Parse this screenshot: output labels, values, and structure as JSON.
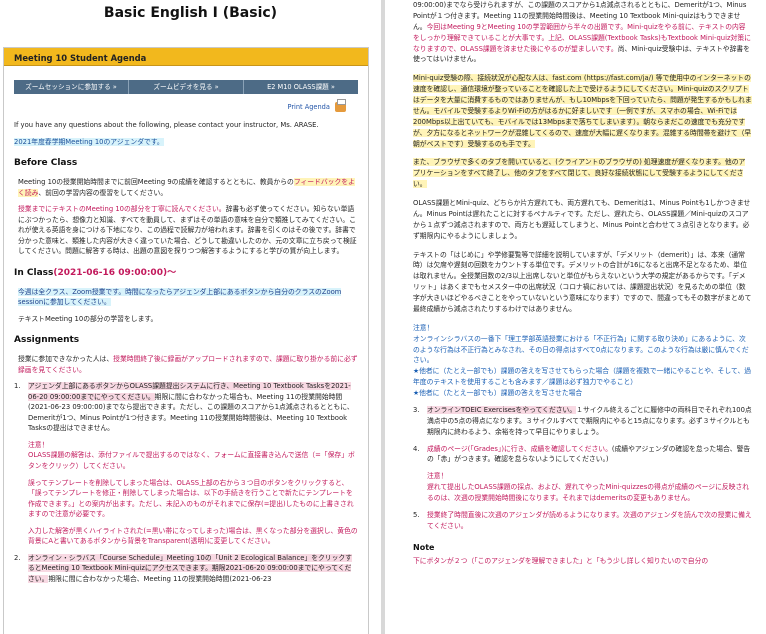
{
  "left": {
    "course_title": "Basic English I (Basic)",
    "agenda_title": "Meeting 10 Student Agenda",
    "nav": [
      "ズームセッションに参加する »",
      "ズームビデオを見る »",
      "E2 M10 OLASS課題 »"
    ],
    "print_label": "Print Agenda",
    "contact_text": "If you have any questions about the following, please contact your instructor, Ms. ARASE.",
    "agenda_year": "2021年度春学期Meeting 10のアジェンダです。",
    "before_class": {
      "heading": "Before Class",
      "p1a": "Meeting 10の授業開始時間までに前回Meeting 9の成績を確認するとともに、教員からの",
      "p1b": "フィードバックをよく読み",
      "p1c": "、前回の学習内容の復習をしてください。",
      "p2a": "授業までにテキストのMeeting 10の部分を丁寧に読んでください。",
      "p2b": "辞書も必ず使ってください。知らない単語にぶつかったら、想像力と知識、すべてを動員して、まずはその単語の意味を自分で類推してみてください。これが使える英語を身につける下地になり、この過程で読解力が培われます。辞書を引くのはその後です。辞書で分かった意味と、類推した内容が大きく違っていた場合、どうして勘違いしたのか、元の文章に立ち戻って検証してください。問題に解答する時は、出題の意図を探りつつ解答するようにすると学びの質が向上します。"
    },
    "in_class": {
      "heading": "In Class",
      "time": "(2021-06-16 09:00:00)～",
      "p1": "今週は全クラス、Zoom授業です。時間になったらアジェンダ上部にあるボタンから自分のクラスのZoom sessionに参加してください。",
      "p2": "テキストMeeting 10の部分の学習をします。"
    },
    "assignments": {
      "heading": "Assignments",
      "intro_a": "授業に参加できなかった人は、",
      "intro_b": "授業時間終了後に録画がアップロードされますので、課題に取り掛かる前に必ず録画を見てください。",
      "items": [
        {
          "num": "1.",
          "a": "アジェンダ上部にあるボタンからOLASS課題提出システムに行き、Meeting 10 Textbook Tasksを2021-06-20 09:00:00までにやってください。",
          "b": "期限に間に合わなかった場合も、Meeting 11の授業開始時間 (2021-06-23 09:00:00)までなら提出できます。ただし、この課題のスコアから1点減点されるとともに、Demeritが1つ、Minus Pointが1つ付きます。Meeting 11の授業開始時間後は、Meeting 10 Textbook Tasksの提出はできません。",
          "note_head": "注意！",
          "note_body": "OLASS課題の解答は、添付ファイルで提出するのではなく、フォームに直接書き込んで送信（=「保存」ボタンをクリック）してください。",
          "p3": "誤ってテンプレートを削除してしまった場合は、OLASS上部の右から３つ目のボタンをクリックすると、「誤ってテンプレートを修正・削除してしまった場合は、以下の手続きを行うことで新たにテンプレートを作成できます。」との案内が出ます。ただし、未記入のものがそれまでに保存(=提出)したものに上書きされますので注意が必要です。",
          "p4": "入力した解答が黒くハイライトされた(=黒い帯になってしまった)場合は、黒くなった部分を選択し、黄色の背景にAと書いてあるボタンから背景をTransparent(透明)に変更してください。"
        },
        {
          "num": "2.",
          "a": "オンライン・シラバス「Course Schedule」Meeting 10の「Unit 2 Ecological Balance」をクリックするとMeeting 10 Textbook Mini-quizにアクセスできます。期限2021-06-20 09:00:00までにやってください。",
          "b": "期限に間に合わなかった場合、Meeting 11の授業開始時間(2021-06-23"
        }
      ]
    }
  },
  "right": {
    "p_cont_a": "09:00:00)までなら受けられますが、この課題のスコアから1点減点されるとともに、Demeritが1つ、Minus Pointが１つ付きます。Meeting 11の授業開始時間後は、Meeting 10 Textbook Mini-quizはもうできません。",
    "p_cont_b": "今回はMeeting 9とMeeting 10の学習範囲から半々の出題です。",
    "p_cont_c": "Mini-quizをやる前に、テキストの内容をしっかり理解できていることが大事です。上記、OLASS課題(Textbook Tasks)もTextbook Mini-quiz対策になりますので、OLASS課題を済ませた後にやるのが望ましいです。",
    "p_cont_d": "尚、Mini-quiz受験中は、テキストや辞書を使ってはいけません。",
    "p_speed": "Mini-quiz受験の際、接続状況が心配な人は、fast.com (https://fast.com/ja/) 等で使用中のインターネットの速度を確認し、通信環境が整っていることを確認した上で受けるようにしてください。Mini-quizのスクリプトはデータを大量に消費するものではありませんが、もし10Mbpsを下回っていたら、問題が発生するかもしれません。モバイルで受験するよりWi-Fiの方がはるかに好ましいです（一例ですが、スマホの場合、Wi-Fiでは200Mbps以上出ていても、モバイルでは13Mbpsまで落ちてしまいます）。朝ならまだこの速度でも充分ですが、夕方になるとネットワークが混雑してくるので、速度が大幅に遅くなります。混雑する時間帯を避けて（早朝がベストです）受験するのも手です。",
    "p_browser": "また、ブラウザで多くのタブを開いていると、(クライアントのブラウザの) 処理速度が遅くなります。他のアプリケーションをすべて終了し、他のタブをすべて閉じて、良好な接続状態にして受験するようにしてください。",
    "p_demerit": "OLASS課題とMini-quiz、どちらか片方遅れても、両方遅れても、Demeritは1、Minus Pointも1しかつきません。Minus Pointは遅れたことに対するペナルティです。ただし、遅れたら、OLASS課題／Mini-quizのスコアから１点ずつ減点されますので、両方とも遅延してしまうと、Minus Pointと合わせて３点引きとなります。必ず期限内にやるようにしましょう。",
    "p_def": "テキストの「はじめに」や学修要覧等で詳細を説明していますが、「デメリット（demerit）」は、本来（通常時）は欠席や遅刻の回数をカウントする単位です。デメリットの合計が16になると出席不足となるため、単位は取れません。全授業回数の2/3以上出席しないと単位がもらえないという大学の規定があるからです。「デメリット」はあくまでもセメスター中の出席状況（コロナ禍においては、課題提出状況）を見るための単位（数字が大きいほどやるべきことをやっていないという意味になります）ですので、間違ってもその数字がまとめて最終成績から減点されたりするわけではありません。",
    "note2_head": "注意！",
    "note2_l1": "オンラインシラバスの一番下「理工学部英語授業における「不正行為」に関する取り決め」にあるように、次のような行為は不正行為とみなされ、その日の得点はすべて0点になります。このような行為は厳に慎んでください。",
    "note2_l2": "★他者に（たとえ一部でも）課題の答えを写させてもらった場合（課題を複数で一緒にやることや、そして、過年度のテキストを使用することも含みます／課題は必ず独力でやること）",
    "note2_l3": "★他者に（たとえ一部でも）課題の答えを写させた場合",
    "items_right": [
      {
        "num": "3.",
        "a": "オンラインTOEIC Exercisesをやってください。",
        "b": "１サイクル終えるごとに履修中の両科目でそれぞれ100点満点中の5点の得点になります。３サイクルすべてで期限内にやると15点になります。必ず３サイクルとも期限内に終わるよう、余裕を持って早目にやりましょう。"
      },
      {
        "num": "4.",
        "a": "成績のページ(「Grades」)に行き、成績を確認してください。",
        "b": "(成績やアジェンダの確認を怠った場合、警告の「赤」がつきます。確認を怠らないようにしてください。)"
      },
      {
        "num": "5.",
        "a": "授業終了時間直後に次週のアジェンダが読めるようになります。次週のアジェンダを読んで次の授業に備えてください。",
        "b": ""
      }
    ],
    "note3_head": "注意！",
    "note3_body": "遅れて提出したOLASS課題の採点、および、遅れてやったMini-quizzesの得点が成績のページに反映されるのは、次週の授業開始時間後になります。それまではdemeritsの変更もありません。",
    "note_title": "Note",
    "note_line": "下にボタンが２つ（「このアジェンダを理解できました」と「もう少し詳しく知りたいので自分の"
  }
}
